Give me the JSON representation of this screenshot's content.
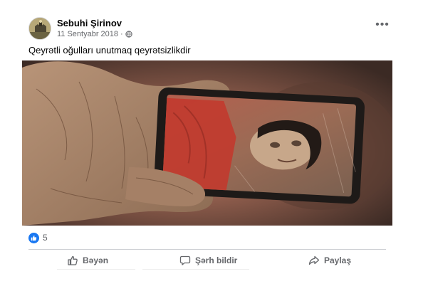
{
  "post": {
    "author": "Sebuhi Şirinov",
    "date": "11 Sentyabr 2018",
    "separator": "·",
    "privacy_icon": "globe-icon",
    "more_icon": "•••",
    "text": "Qeyrətli oğulları unutmaq qeyrətsizlikdir"
  },
  "reactions": {
    "icon": "like-reaction-icon",
    "count": "5"
  },
  "actions": {
    "like_label": "Bəyən",
    "comment_label": "Şərh bildir",
    "share_label": "Paylaş"
  },
  "colors": {
    "secondary_text": "#65676b",
    "like_blue": "#1877f2",
    "divider": "#ced0d4"
  }
}
